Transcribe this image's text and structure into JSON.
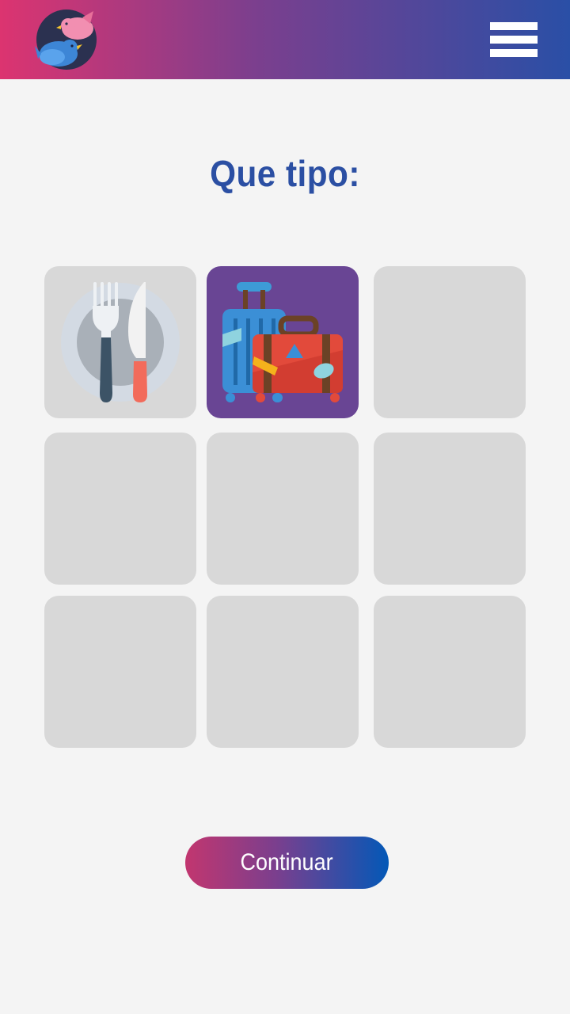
{
  "header": {
    "logo_icon": "birds-logo-icon",
    "menu_icon": "hamburger-menu-icon",
    "gradient_start": "#dc3470",
    "gradient_end": "#2a4fa6"
  },
  "main": {
    "title": "Que tipo:",
    "title_color": "#2b4fa3",
    "tiles": [
      {
        "icon": "plate-fork-knife-icon",
        "selected": false
      },
      {
        "icon": "luggage-suitcases-icon",
        "selected": true
      },
      {
        "icon": "",
        "selected": false
      },
      {
        "icon": "",
        "selected": false
      },
      {
        "icon": "",
        "selected": false
      },
      {
        "icon": "",
        "selected": false
      },
      {
        "icon": "",
        "selected": false
      },
      {
        "icon": "",
        "selected": false
      },
      {
        "icon": "",
        "selected": false
      }
    ]
  },
  "footer": {
    "continue_label": "Continuar"
  }
}
